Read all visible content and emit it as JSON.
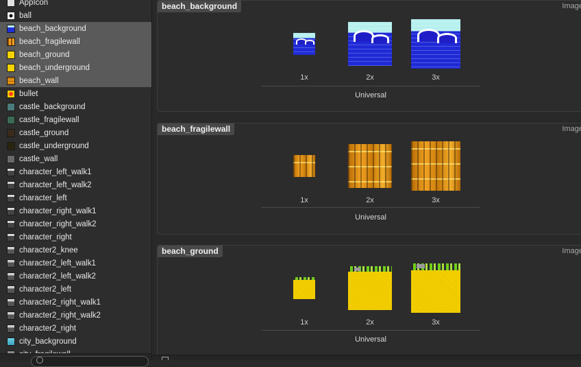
{
  "sidebar": {
    "items": [
      {
        "label": "AppIcon",
        "icon": "appicon-thumbnail",
        "selected": false
      },
      {
        "label": "ball",
        "icon": "ball-thumbnail",
        "selected": false
      },
      {
        "label": "beach_background",
        "icon": "beach-background-thumbnail",
        "selected": true
      },
      {
        "label": "beach_fragilewall",
        "icon": "fragilewall-thumbnail",
        "selected": true
      },
      {
        "label": "beach_ground",
        "icon": "ground-thumbnail",
        "selected": true
      },
      {
        "label": "beach_underground",
        "icon": "underground-thumbnail",
        "selected": true
      },
      {
        "label": "beach_wall",
        "icon": "wall-thumbnail",
        "selected": true
      },
      {
        "label": "bullet",
        "icon": "bullet-thumbnail",
        "selected": false
      },
      {
        "label": "castle_background",
        "icon": "castle-background-thumbnail",
        "selected": false
      },
      {
        "label": "castle_fragilewall",
        "icon": "castle-fragilewall-thumbnail",
        "selected": false
      },
      {
        "label": "castle_ground",
        "icon": "castle-ground-thumbnail",
        "selected": false
      },
      {
        "label": "castle_underground",
        "icon": "castle-underground-thumbnail",
        "selected": false
      },
      {
        "label": "castle_wall",
        "icon": "castle-wall-thumbnail",
        "selected": false
      },
      {
        "label": "character_left_walk1",
        "icon": "character-thumbnail",
        "selected": false
      },
      {
        "label": "character_left_walk2",
        "icon": "character-thumbnail",
        "selected": false
      },
      {
        "label": "character_left",
        "icon": "character-thumbnail",
        "selected": false
      },
      {
        "label": "character_right_walk1",
        "icon": "character-thumbnail",
        "selected": false
      },
      {
        "label": "character_right_walk2",
        "icon": "character-thumbnail",
        "selected": false
      },
      {
        "label": "character_right",
        "icon": "character-thumbnail",
        "selected": false
      },
      {
        "label": "character2_knee",
        "icon": "character2-thumbnail",
        "selected": false
      },
      {
        "label": "character2_left_walk1",
        "icon": "character2-thumbnail",
        "selected": false
      },
      {
        "label": "character2_left_walk2",
        "icon": "character2-thumbnail",
        "selected": false
      },
      {
        "label": "character2_left",
        "icon": "character2-thumbnail",
        "selected": false
      },
      {
        "label": "character2_right_walk1",
        "icon": "character2-thumbnail",
        "selected": false
      },
      {
        "label": "character2_right_walk2",
        "icon": "character2-thumbnail",
        "selected": false
      },
      {
        "label": "character2_right",
        "icon": "character2-thumbnail",
        "selected": false
      },
      {
        "label": "city_background",
        "icon": "city-background-thumbnail",
        "selected": false
      },
      {
        "label": "city_fragilewall",
        "icon": "city-fragilewall-thumbnail",
        "selected": false
      }
    ]
  },
  "image_sets": [
    {
      "name": "beach_background",
      "type": "Image",
      "art": "beach-background",
      "scales": [
        "1x",
        "2x",
        "3x"
      ],
      "device": "Universal"
    },
    {
      "name": "beach_fragilewall",
      "type": "Image",
      "art": "beach-fragilewall",
      "scales": [
        "1x",
        "2x",
        "3x"
      ],
      "device": "Universal"
    },
    {
      "name": "beach_ground",
      "type": "Image",
      "art": "beach-ground",
      "scales": [
        "1x",
        "2x",
        "3x"
      ],
      "device": "Universal"
    }
  ],
  "colors": {
    "selection": "#5a5a5a",
    "sky": "#b6f0ee",
    "water": "#1f2ad6",
    "wall": "#f0a020",
    "ground": "#f6d200",
    "grass": "#6fd01a"
  }
}
